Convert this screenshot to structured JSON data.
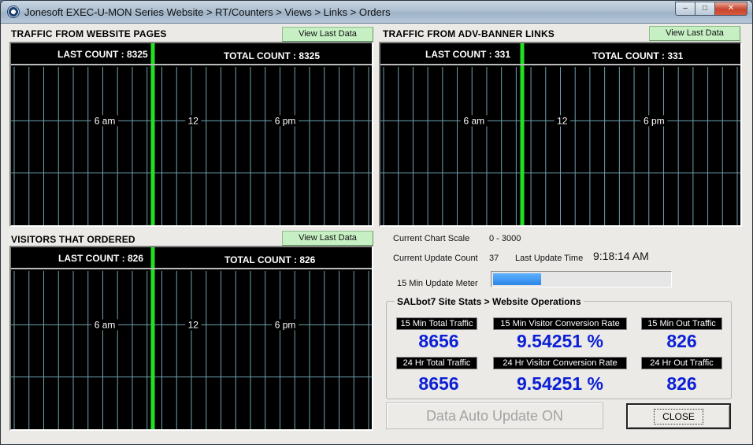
{
  "window": {
    "title": "Jonesoft EXEC-U-MON Series Website > RT/Counters > Views > Links > Orders",
    "minimize_glyph": "‒",
    "maximize_glyph": "□",
    "close_glyph": "✕"
  },
  "panels": [
    {
      "title": "TRAFFIC FROM WEBSITE PAGES",
      "button": "View Last Data",
      "last_count": "LAST COUNT : 8325",
      "total_count": "TOTAL COUNT : 8325",
      "axis_labels": [
        "6 am",
        "12",
        "6 pm"
      ]
    },
    {
      "title": "TRAFFIC FROM ADV-BANNER LINKS",
      "button": "View Last Data",
      "last_count": "LAST COUNT : 331",
      "total_count": "TOTAL COUNT : 331",
      "axis_labels": [
        "6 am",
        "12",
        "6 pm"
      ]
    },
    {
      "title": "VISITORS THAT ORDERED",
      "button": "View Last Data",
      "last_count": "LAST COUNT : 826",
      "total_count": "TOTAL COUNT : 826",
      "axis_labels": [
        "6 am",
        "12",
        "6 pm"
      ]
    }
  ],
  "info": {
    "chart_scale_label": "Current Chart Scale",
    "chart_scale_value": "0 - 3000",
    "update_count_label": "Current Update Count",
    "update_count_value": "37",
    "last_update_label": "Last Update Time",
    "last_update_value": "9:18:14 AM",
    "meter_label": "15 Min Update Meter",
    "meter_fraction": 0.27
  },
  "stats": {
    "title": "SALbot7 Site Stats > Website Operations",
    "items": [
      {
        "label": "15 Min Total Traffic",
        "value": "8656"
      },
      {
        "label": "15 Min Visitor Conversion Rate",
        "value": "9.54251 %"
      },
      {
        "label": "15 Min Out Traffic",
        "value": "826"
      },
      {
        "label": "24 Hr Total Traffic",
        "value": "8656"
      },
      {
        "label": "24 Hr Visitor Conversion Rate",
        "value": "9.54251 %"
      },
      {
        "label": "24 Hr Out Traffic",
        "value": "826"
      }
    ]
  },
  "buttons": {
    "auto_update": "Data Auto Update ON",
    "close": "CLOSE"
  },
  "colors": {
    "grid_line": "#6f9fae",
    "time_cursor": "#22e022",
    "stat_value": "#0a1fd6",
    "view_button": "#c6f0c3"
  }
}
